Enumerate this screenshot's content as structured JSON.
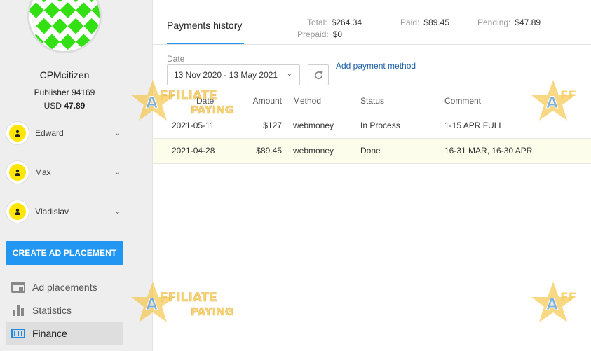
{
  "profile": {
    "username": "CPMcitizen",
    "publisher": "Publisher 94169",
    "currency": "USD",
    "balance": "47.89"
  },
  "managers": [
    {
      "name": "Edward",
      "icon": "person-icon"
    },
    {
      "name": "Max",
      "icon": "person-icon"
    },
    {
      "name": "Vladislav",
      "icon": "person-icon"
    }
  ],
  "create_button": "CREATE AD PLACEMENT",
  "nav": [
    {
      "label": "Ad placements",
      "icon": "ad-placements-icon"
    },
    {
      "label": "Statistics",
      "icon": "bar-chart-icon"
    },
    {
      "label": "Finance",
      "icon": "finance-icon",
      "active": true
    }
  ],
  "header": {
    "tab": "Payments history",
    "total_label": "Total:",
    "total": "$264.34",
    "prepaid_label": "Prepaid:",
    "prepaid": "$0",
    "paid_label": "Paid:",
    "paid": "$89.45",
    "pending_label": "Pending:",
    "pending": "$47.89"
  },
  "filters": {
    "date_label": "Date",
    "date_range": "13 Nov 2020 - 13 May 2021",
    "add_method": "Add payment method"
  },
  "table": {
    "headers": [
      "Date",
      "Amount",
      "Method",
      "Status",
      "Comment"
    ],
    "rows": [
      {
        "date": "2021-05-11",
        "amount": "$127",
        "method": "webmoney",
        "status": "In Process",
        "comment": "1-15 APR FULL"
      },
      {
        "date": "2021-04-28",
        "amount": "$89.45",
        "method": "webmoney",
        "status": "Done",
        "comment": "16-31 MAR, 16-30 APR"
      }
    ]
  },
  "watermark": {
    "line1": "AFFILIATE",
    "line2": "PAYING"
  },
  "colors": {
    "accent": "#2196f3",
    "avatar_green": "#33e014",
    "manager_yellow": "#ffe600",
    "highlight_row": "#fdfdec",
    "link": "#1e5fa8"
  }
}
